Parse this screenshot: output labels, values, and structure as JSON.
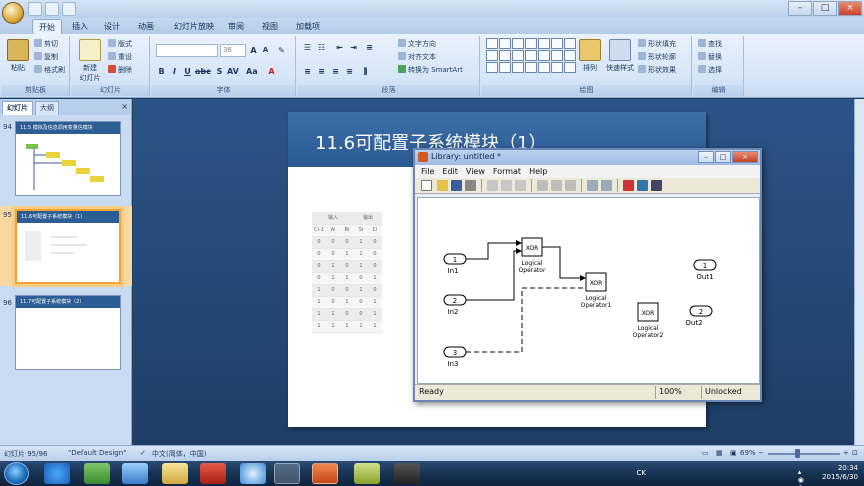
{
  "ribbon": {
    "tabs": [
      "开始",
      "插入",
      "设计",
      "动画",
      "幻灯片放映",
      "审阅",
      "视图",
      "加载项"
    ],
    "groups": {
      "clipboard": {
        "label": "剪贴板",
        "paste": "粘贴",
        "cut": "剪切",
        "copy": "复制",
        "format_painter": "格式刷"
      },
      "slides": {
        "label": "幻灯片",
        "new_slide": "新建\n幻灯片",
        "layout": "版式",
        "reset": "重设",
        "delete": "删除"
      },
      "font": {
        "label": "字体",
        "font_size": "36"
      },
      "paragraph": {
        "label": "段落",
        "text_direction": "文字方向",
        "align_text": "对齐文本",
        "smartart": "转换为 SmartArt"
      },
      "drawing": {
        "label": "绘图",
        "arrange": "排列",
        "quick_styles": "快速样式",
        "shape_fill": "形状填充",
        "shape_outline": "形状轮廓",
        "shape_effects": "形状效果"
      },
      "editing": {
        "label": "编辑",
        "find": "查找",
        "replace": "替换",
        "select": "选择"
      }
    }
  },
  "left_panel": {
    "tabs": [
      "幻灯片",
      "大纲"
    ],
    "close": "×",
    "slides": [
      {
        "number": "94",
        "title": "11.5 模拟及信息调用变量信模块"
      },
      {
        "number": "95",
        "title": "11.6可配置子系统模块（1）"
      },
      {
        "number": "96",
        "title": "11.7可配置子系统模块（2）"
      }
    ]
  },
  "slide": {
    "title": "11.6可配置子系统模块（1）",
    "table_header": [
      "输入",
      "输出"
    ],
    "table_cols": [
      "Ci-1",
      "Ai",
      "Bi",
      "Si",
      "Ci"
    ],
    "table_rows": [
      [
        "0",
        "0",
        "0",
        "1",
        "0"
      ],
      [
        "0",
        "0",
        "1",
        "1",
        "0"
      ],
      [
        "0",
        "1",
        "0",
        "1",
        "0"
      ],
      [
        "0",
        "1",
        "1",
        "0",
        "1"
      ],
      [
        "1",
        "0",
        "0",
        "1",
        "0"
      ],
      [
        "1",
        "0",
        "1",
        "0",
        "1"
      ],
      [
        "1",
        "1",
        "0",
        "0",
        "1"
      ],
      [
        "1",
        "1",
        "1",
        "1",
        "1"
      ]
    ]
  },
  "library_window": {
    "title": "Library: untitled *",
    "menu": [
      "File",
      "Edit",
      "View",
      "Format",
      "Help"
    ],
    "status": {
      "ready": "Ready",
      "zoom": "100%",
      "lock": "Unlocked"
    },
    "blocks": {
      "in1": {
        "num": "1",
        "label": "In1"
      },
      "in2": {
        "num": "2",
        "label": "In2"
      },
      "in3": {
        "num": "3",
        "label": "In3"
      },
      "xor1": {
        "op": "XOR",
        "label": "Logical\nOperator"
      },
      "xor2": {
        "op": "XOR",
        "label": "Logical\nOperator1"
      },
      "xor3": {
        "op": "XOR",
        "label": "Logical\nOperator2"
      },
      "out1": {
        "num": "1",
        "label": "Out1"
      },
      "out2": {
        "num": "2",
        "label": "Out2"
      }
    }
  },
  "statusbar": {
    "slide_info": "幻灯片 95/96",
    "theme": "\"Default Design\"",
    "language": "中文(简体，中国)",
    "zoom": "69%"
  },
  "taskbar": {
    "time": "20:34",
    "date": "2015/6/30",
    "ime": "CK"
  },
  "colors": {
    "accent": "#2b5a92",
    "selection": "#f2a338",
    "taskbar": "#16314f"
  }
}
